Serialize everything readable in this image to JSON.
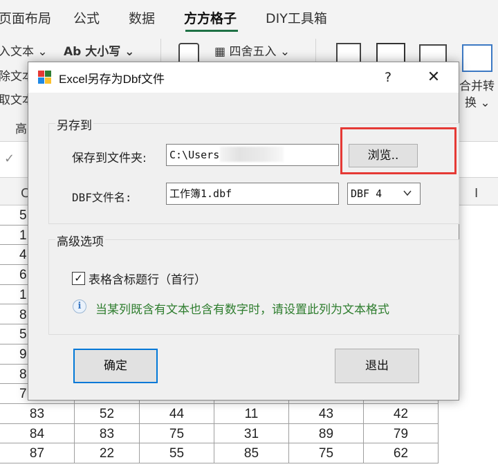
{
  "ribbon": {
    "tabs": [
      "页面布局",
      "公式",
      "数据",
      "方方格子",
      "DIY工具箱"
    ],
    "active_tab": "方方格子",
    "items": {
      "text": "入文本",
      "case": "大小写",
      "case_prefix": "Ab",
      "round": "四舍五入",
      "del_text": "除文本",
      "take_text": "取文本",
      "high": "高",
      "merge": "合并转",
      "merge2": "换"
    }
  },
  "sheet": {
    "col_label_left": "C",
    "col_label_right": "I",
    "partial_rows": [
      "5",
      "1",
      "4",
      "6",
      "1",
      "8",
      "5",
      "9",
      "8",
      "7"
    ],
    "rows": [
      [
        "83",
        "52",
        "44",
        "11",
        "43",
        "42"
      ],
      [
        "84",
        "83",
        "75",
        "31",
        "89",
        "79"
      ],
      [
        "87",
        "22",
        "55",
        "85",
        "75",
        "62"
      ]
    ]
  },
  "dialog": {
    "title": "Excel另存为Dbf文件",
    "help": "?",
    "close": "✕",
    "save_group": {
      "label": "另存到",
      "folder_label": "保存到文件夹:",
      "folder_value": "C:\\Users'                 Desktop",
      "browse_button": "浏览..",
      "dbf_label": "DBF文件名:",
      "dbf_value": "工作簿1.dbf",
      "dbf_type": "DBF 4"
    },
    "advanced_group": {
      "label": "高级选项",
      "checkbox_label": "表格含标题行（首行）",
      "checkbox_checked": true,
      "info_text": "当某列既含有文本也含有数字时，请设置此列为文本格式"
    },
    "ok_button": "确定",
    "exit_button": "退出"
  },
  "colors": {
    "info_green": "#2e7d2e",
    "highlight_red": "#e53935",
    "excel_green": "#1e7145",
    "ok_border": "#0078d7"
  }
}
